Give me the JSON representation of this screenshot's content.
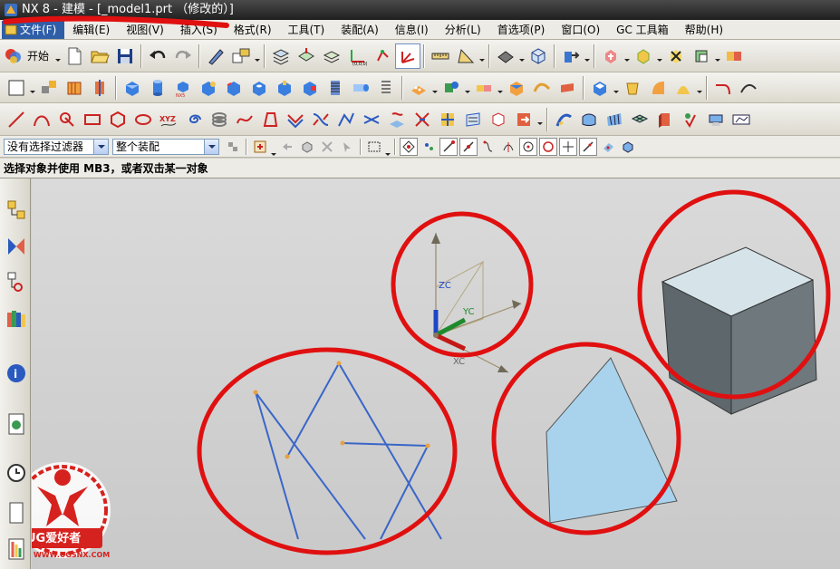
{
  "window": {
    "title": "NX 8 - 建模 - [_model1.prt （修改的）]"
  },
  "menu": [
    {
      "label": "文件(F)",
      "name": "menu-file"
    },
    {
      "label": "编辑(E)",
      "name": "menu-edit"
    },
    {
      "label": "视图(V)",
      "name": "menu-view"
    },
    {
      "label": "插入(S)",
      "name": "menu-insert"
    },
    {
      "label": "格式(R)",
      "name": "menu-format"
    },
    {
      "label": "工具(T)",
      "name": "menu-tools"
    },
    {
      "label": "装配(A)",
      "name": "menu-assemblies"
    },
    {
      "label": "信息(I)",
      "name": "menu-information"
    },
    {
      "label": "分析(L)",
      "name": "menu-analysis"
    },
    {
      "label": "首选项(P)",
      "name": "menu-preferences"
    },
    {
      "label": "窗口(O)",
      "name": "menu-window"
    },
    {
      "label": "GC 工具箱",
      "name": "menu-gc-toolkit"
    },
    {
      "label": "帮助(H)",
      "name": "menu-help"
    }
  ],
  "toolbar": {
    "start_label": "开始"
  },
  "selection": {
    "filter_value": "没有选择过滤器",
    "scope_value": "整个装配"
  },
  "cue_line": "选择对象并使用 MB3，或者双击某一对象",
  "triad": {
    "zc_label": "ZC",
    "yc_label": "YC",
    "xc_label": "XC"
  },
  "watermark": {
    "brand": "UG爱好者",
    "url": "WWW.UGSNX.COM"
  },
  "colors": {
    "title_bg": "#2a2a2a",
    "annotation_red": "#e01010",
    "curve_blue": "#3a66c8",
    "sheet_fill": "#a9d3ec",
    "block_top": "#d6e4ea",
    "block_side": "#5d676c"
  }
}
